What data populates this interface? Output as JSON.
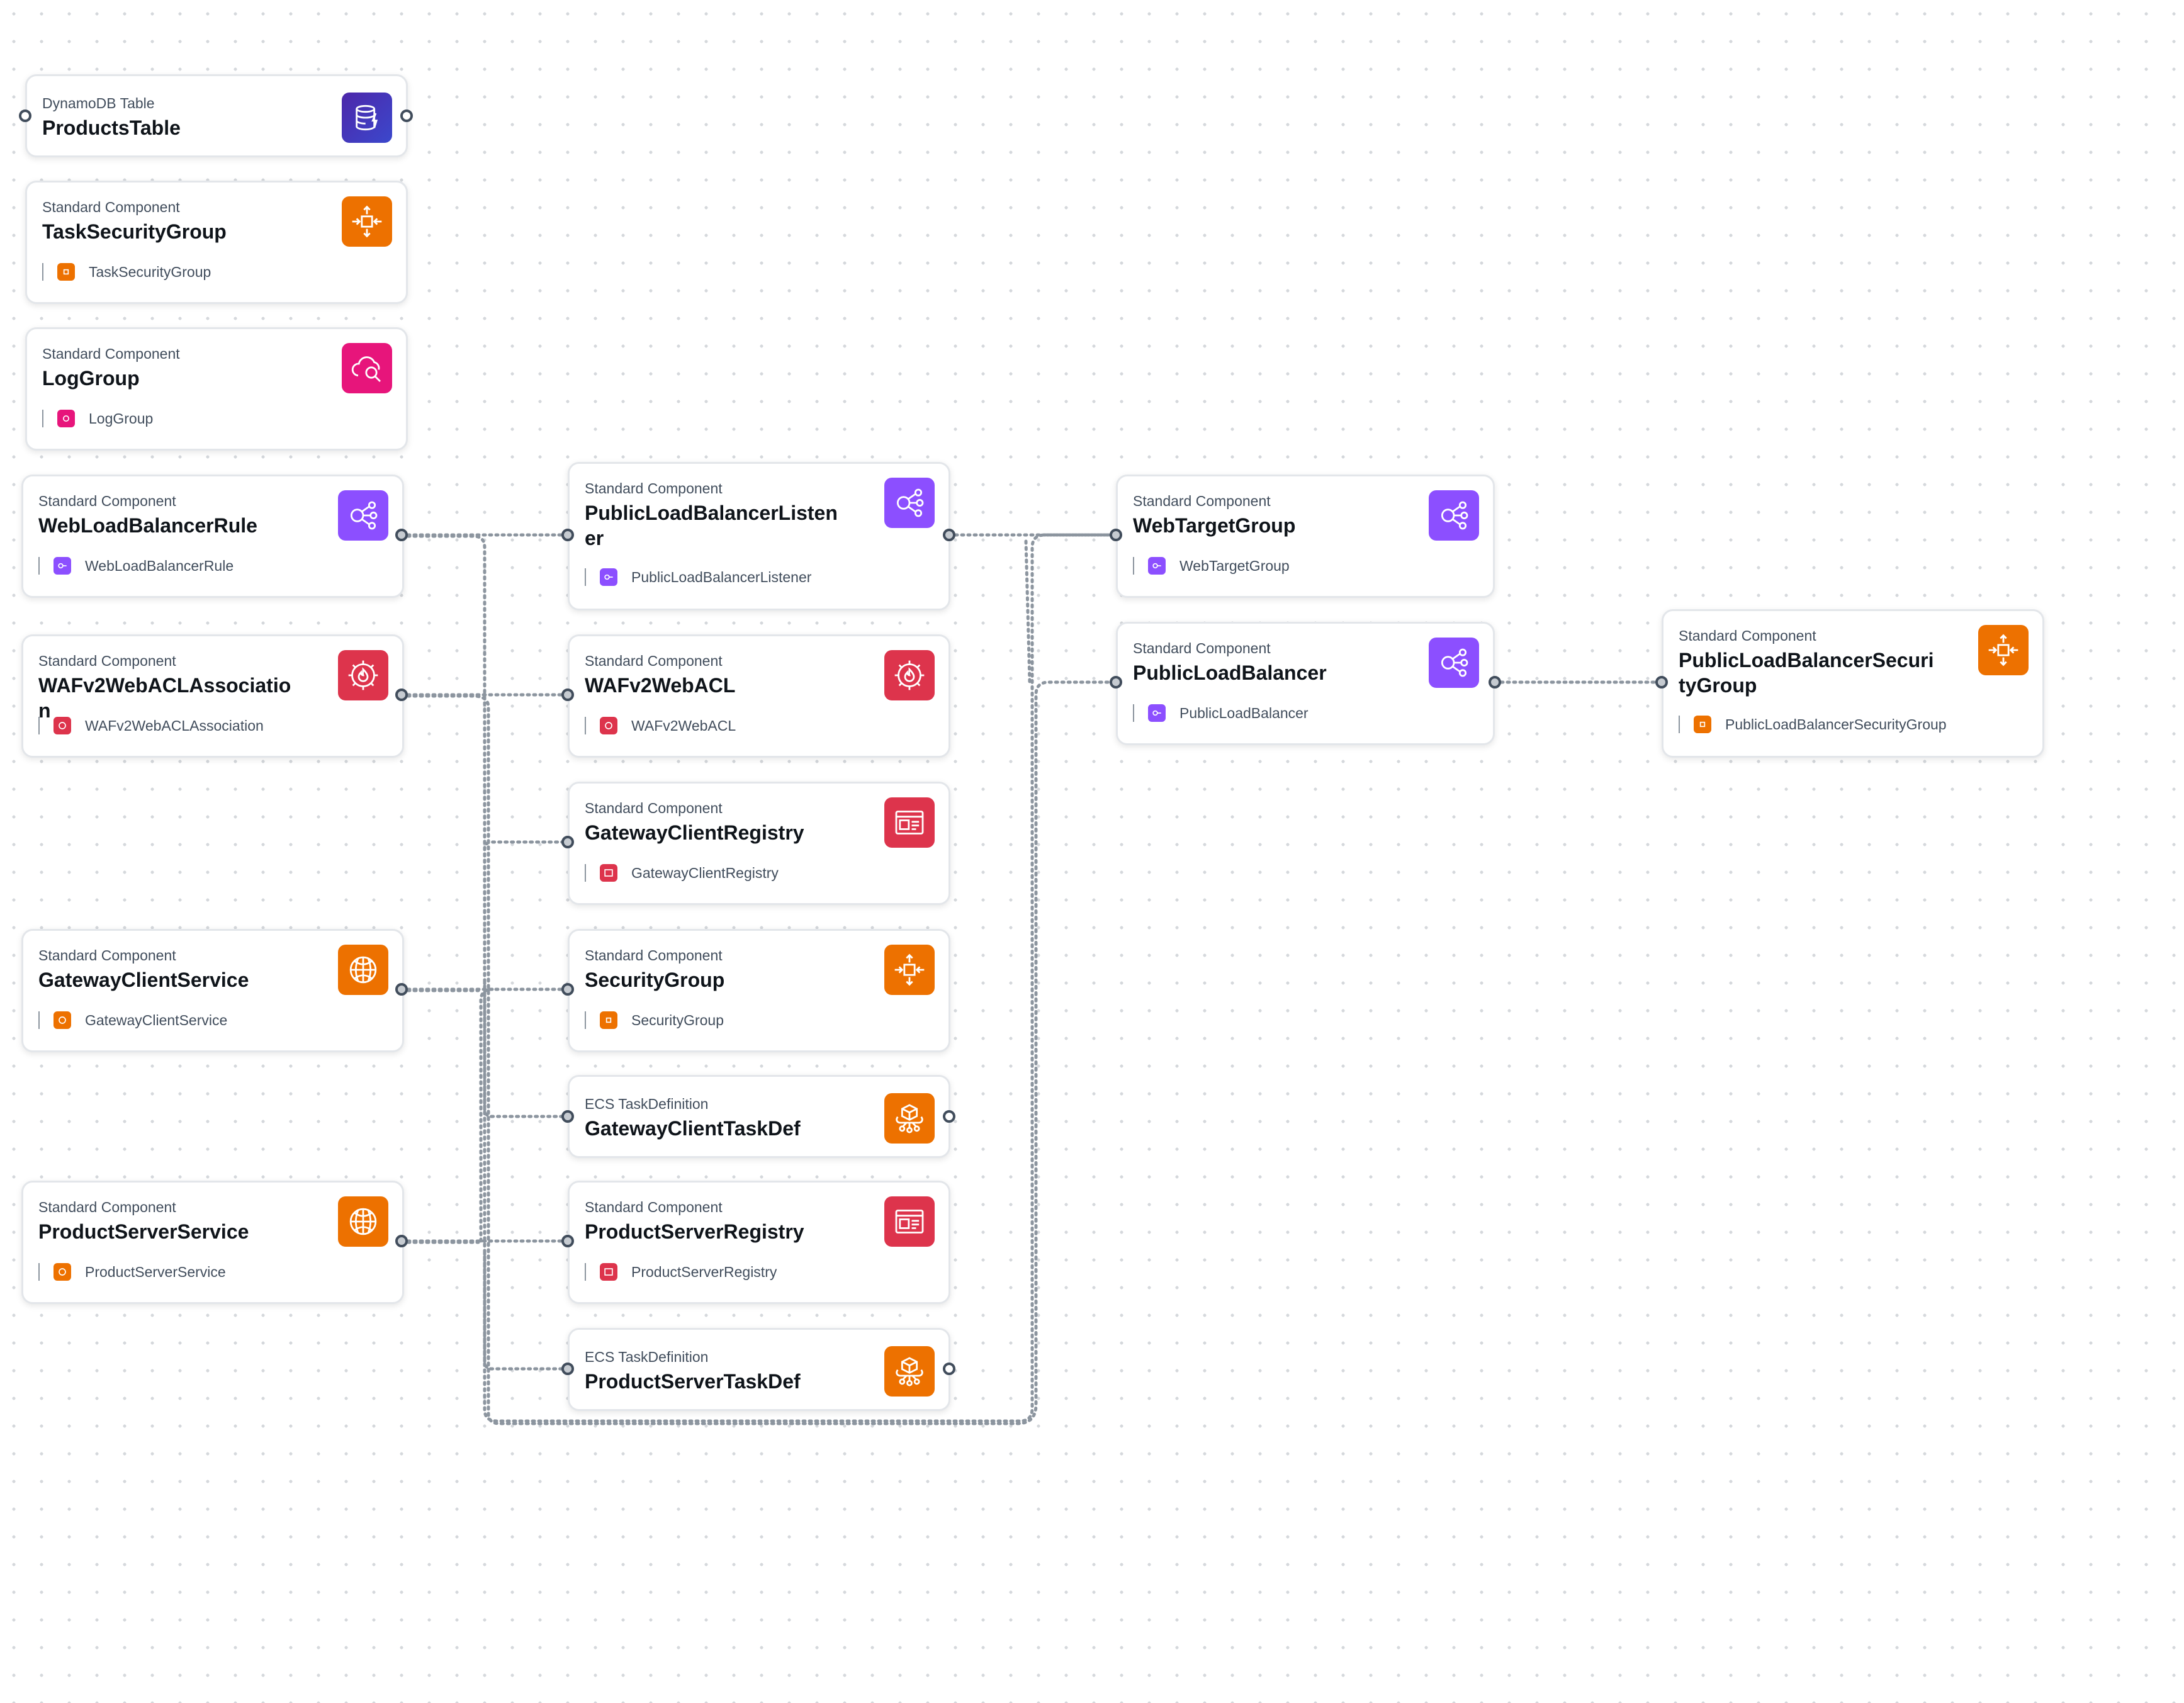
{
  "colors": {
    "compute": "#ed7100",
    "networking": "#8c4fff",
    "security": "#dd344c",
    "management": "#e7157b",
    "database": "#3b48cc",
    "edge": "#8c959f",
    "port_stroke": "#414d5c"
  },
  "nodes": {
    "products_table": {
      "type": "DynamoDB Table",
      "name": "ProductsTable",
      "icon": "dynamodb-icon"
    },
    "task_security_group": {
      "type": "Standard Component",
      "name": "TaskSecurityGroup",
      "sub": "TaskSecurityGroup",
      "icon": "security-group-icon"
    },
    "log_group": {
      "type": "Standard Component",
      "name": "LogGroup",
      "sub": "LogGroup",
      "icon": "log-group-icon"
    },
    "web_lb_rule": {
      "type": "Standard Component",
      "name": "WebLoadBalancerRule",
      "sub": "WebLoadBalancerRule",
      "icon": "load-balancer-icon"
    },
    "waf_association": {
      "type": "Standard Component",
      "name": "WAFv2WebACLAssociation",
      "sub": "WAFv2WebACLAssociation",
      "icon": "waf-icon"
    },
    "gateway_client_service": {
      "type": "Standard Component",
      "name": "GatewayClientService",
      "sub": "GatewayClientService",
      "icon": "ecs-service-icon"
    },
    "product_server_service": {
      "type": "Standard Component",
      "name": "ProductServerService",
      "sub": "ProductServerService",
      "icon": "ecs-service-icon"
    },
    "public_lb_listener": {
      "type": "Standard Component",
      "name": "PublicLoadBalancerListen\ner",
      "sub": "PublicLoadBalancerListener",
      "icon": "load-balancer-icon"
    },
    "waf_web_acl": {
      "type": "Standard Component",
      "name": "WAFv2WebACL",
      "sub": "WAFv2WebACL",
      "icon": "waf-icon"
    },
    "gateway_client_registry": {
      "type": "Standard Component",
      "name": "GatewayClientRegistry",
      "sub": "GatewayClientRegistry",
      "icon": "registry-icon"
    },
    "security_group": {
      "type": "Standard Component",
      "name": "SecurityGroup",
      "sub": "SecurityGroup",
      "icon": "security-group-icon"
    },
    "gateway_client_taskdef": {
      "type": "ECS TaskDefinition",
      "name": "GatewayClientTaskDef",
      "icon": "task-definition-icon"
    },
    "product_server_registry": {
      "type": "Standard Component",
      "name": "ProductServerRegistry",
      "sub": "ProductServerRegistry",
      "icon": "registry-icon"
    },
    "product_server_taskdef": {
      "type": "ECS TaskDefinition",
      "name": "ProductServerTaskDef",
      "icon": "task-definition-icon"
    },
    "web_target_group": {
      "type": "Standard Component",
      "name": "WebTargetGroup",
      "sub": "WebTargetGroup",
      "icon": "load-balancer-icon"
    },
    "public_load_balancer": {
      "type": "Standard Component",
      "name": "PublicLoadBalancer",
      "sub": "PublicLoadBalancer",
      "icon": "load-balancer-icon"
    },
    "public_lb_security_group": {
      "type": "Standard Component",
      "name": "PublicLoadBalancerSecuri\ntyGroup",
      "sub": "PublicLoadBalancerSecurityGroup",
      "icon": "security-group-icon"
    }
  },
  "connections": [
    [
      "web_lb_rule",
      "public_lb_listener"
    ],
    [
      "web_lb_rule",
      "web_target_group"
    ],
    [
      "waf_association",
      "waf_web_acl"
    ],
    [
      "waf_association",
      "public_load_balancer"
    ],
    [
      "gateway_client_service",
      "gateway_client_registry"
    ],
    [
      "gateway_client_service",
      "security_group"
    ],
    [
      "gateway_client_service",
      "gateway_client_taskdef"
    ],
    [
      "gateway_client_service",
      "web_target_group"
    ],
    [
      "product_server_service",
      "product_server_registry"
    ],
    [
      "product_server_service",
      "product_server_taskdef"
    ],
    [
      "product_server_service",
      "security_group"
    ],
    [
      "public_lb_listener",
      "web_target_group"
    ],
    [
      "public_lb_listener",
      "public_load_balancer"
    ],
    [
      "public_load_balancer",
      "public_lb_security_group"
    ]
  ]
}
